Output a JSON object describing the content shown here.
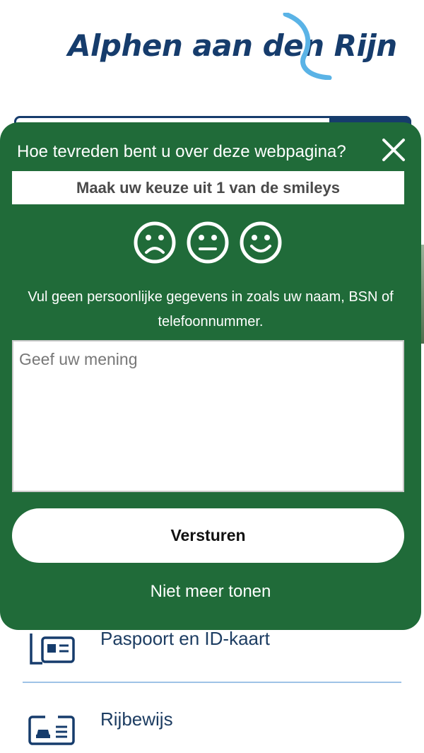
{
  "brand": {
    "logo_text": "Alphen aan den Rijn",
    "colors": {
      "brand_blue": "#163c6c",
      "swoosh": "#5ab3e6",
      "feedback_green": "#206b39"
    }
  },
  "services": [
    {
      "label": "Paspoort en ID-kaart",
      "icon": "passport-id-card-icon"
    },
    {
      "label": "Rijbewijs",
      "icon": "driving-license-icon"
    }
  ],
  "feedback": {
    "title": "Hoe tevreden bent u over deze webpagina?",
    "close_icon": "close-icon",
    "instruction": "Maak uw keuze uit 1 van de smileys",
    "smileys": [
      "sad-smiley-icon",
      "neutral-smiley-icon",
      "happy-smiley-icon"
    ],
    "privacy_note": "Vul geen persoonlijke gegevens in zoals uw naam, BSN of telefoonnummer.",
    "input_value": "",
    "input_placeholder": "Geef uw mening",
    "submit_label": "Versturen",
    "dismiss_label": "Niet meer tonen"
  }
}
